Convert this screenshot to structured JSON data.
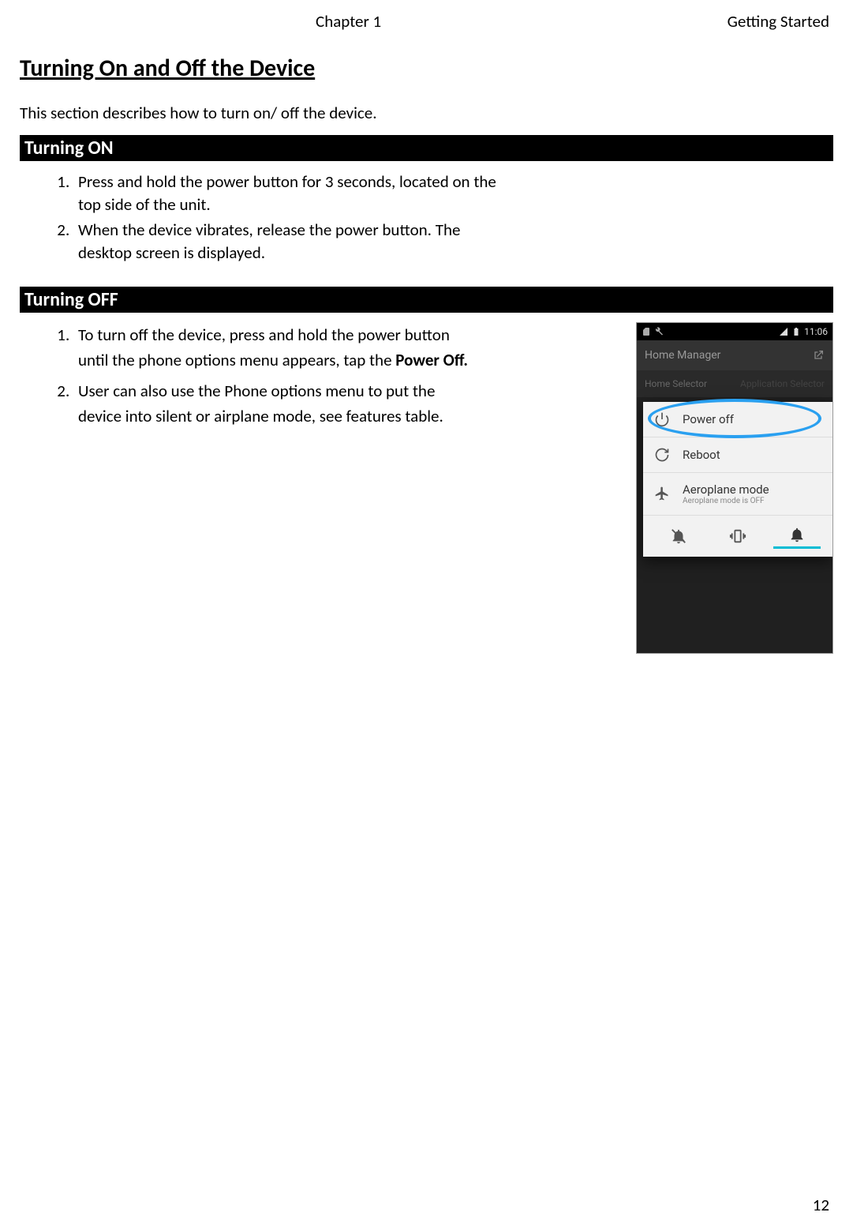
{
  "header": {
    "chapter": "Chapter 1",
    "section": "Getting Started"
  },
  "title": "Turning On and Off the Device",
  "intro": "This section describes how to turn on/ off the device.",
  "sections": {
    "on": {
      "heading": "Turning ON",
      "steps": [
        "Press and hold the power button for 3 seconds, located on the top side of the unit.",
        "When the device vibrates, release the power button. The desktop screen is displayed."
      ]
    },
    "off": {
      "heading": "Turning OFF",
      "step1_a": "To turn off the device, press and hold the power button until the phone options menu appears, tap the ",
      "step1_b": "Power Off.",
      "step2": "User can also use the Phone options menu to put the device into silent or airplane mode, see features table."
    }
  },
  "phone": {
    "time": "11:06",
    "topbar": "Home Manager",
    "subbar_left": "Home Selector",
    "subbar_right": "Application Selector",
    "menu": {
      "poweroff": "Power off",
      "reboot": "Reboot",
      "aero": "Aeroplane mode",
      "aero_sub": "Aeroplane mode is OFF"
    }
  },
  "page_number": "12"
}
